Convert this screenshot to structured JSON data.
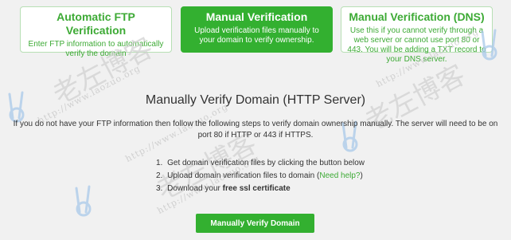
{
  "cards": {
    "auto": {
      "title": "Automatic FTP Verification",
      "desc": "Enter FTP information to automatically verify the domain"
    },
    "manual": {
      "title": "Manual Verification",
      "desc": "Upload verification files manually to your domain to verify ownership."
    },
    "dns": {
      "title": "Manual Verification (DNS)",
      "desc": "Use this if you cannot verify through a web server or cannot use port 80 or 443. You will be adding a TXT record to your DNS server."
    }
  },
  "main": {
    "title": "Manually Verify Domain (HTTP Server)",
    "description": "If you do not have your FTP information then follow the following steps to verify domain ownership manually. The server will need to be on port 80 if HTTP or 443 if HTTPS.",
    "steps": [
      {
        "num": "1.",
        "text": "Get domain verification files by clicking the button below"
      },
      {
        "num": "2.",
        "text_before": "Upload domain verification files to domain (",
        "link": "Need help?",
        "text_after": ")"
      },
      {
        "num": "3.",
        "text_before": "Download your ",
        "bold": "free ssl certificate"
      }
    ],
    "button_label": "Manually Verify Domain"
  },
  "watermark": {
    "cn": "老左博客",
    "url": "http://www.laozuo.org"
  },
  "colors": {
    "accent": "#33b030",
    "accent_text": "#3daa35",
    "background": "#f1f1f1"
  }
}
